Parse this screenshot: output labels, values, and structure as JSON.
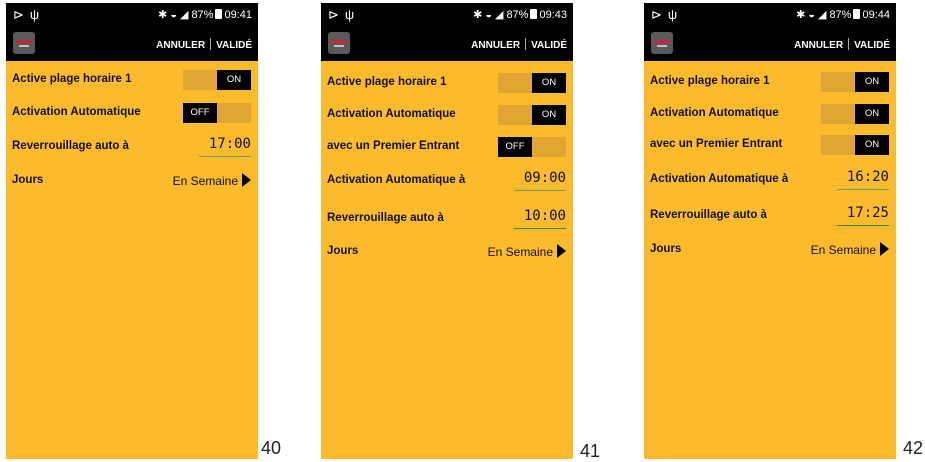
{
  "screens": [
    {
      "status": {
        "time": "09:41",
        "battery": "87%"
      },
      "appbar": {
        "cancel": "ANNULER",
        "validate": "VALIDÉ"
      },
      "rows": {
        "plage": {
          "label": "Active plage horaire 1",
          "toggle": "ON"
        },
        "activation": {
          "label": "Activation Automatique",
          "toggle": "OFF"
        },
        "reverrou": {
          "label": "Reverrouillage auto à",
          "time": "17:00"
        },
        "jours": {
          "label": "Jours",
          "value": "En Semaine"
        }
      },
      "page_number": "40"
    },
    {
      "status": {
        "time": "09:43",
        "battery": "87%"
      },
      "appbar": {
        "cancel": "ANNULER",
        "validate": "VALIDÉ"
      },
      "rows": {
        "plage": {
          "label": "Active plage horaire 1",
          "toggle": "ON"
        },
        "activation": {
          "label": "Activation Automatique",
          "toggle": "ON"
        },
        "premier": {
          "label": "avec un Premier Entrant",
          "toggle": "OFF"
        },
        "activation_time": {
          "label": "Activation Automatique à",
          "time": "09:00"
        },
        "reverrou": {
          "label": "Reverrouillage auto à",
          "time": "10:00"
        },
        "jours": {
          "label": "Jours",
          "value": "En Semaine"
        }
      },
      "page_number": "41"
    },
    {
      "status": {
        "time": "09:44",
        "battery": "87%"
      },
      "appbar": {
        "cancel": "ANNULER",
        "validate": "VALIDÉ"
      },
      "rows": {
        "plage": {
          "label": "Active plage horaire 1",
          "toggle": "ON"
        },
        "activation": {
          "label": "Activation Automatique",
          "toggle": "ON"
        },
        "premier": {
          "label": "avec un Premier Entrant",
          "toggle": "ON"
        },
        "activation_time": {
          "label": "Activation Automatique à",
          "time": "16:20"
        },
        "reverrou": {
          "label": "Reverrouillage auto à",
          "time": "17:25"
        },
        "jours": {
          "label": "Jours",
          "value": "En Semaine"
        }
      },
      "page_number": "42"
    }
  ],
  "colors": {
    "background": "#fcba2d",
    "toggle_track": "#e0a631",
    "toggle_knob": "#000000",
    "bar": "#000000"
  }
}
